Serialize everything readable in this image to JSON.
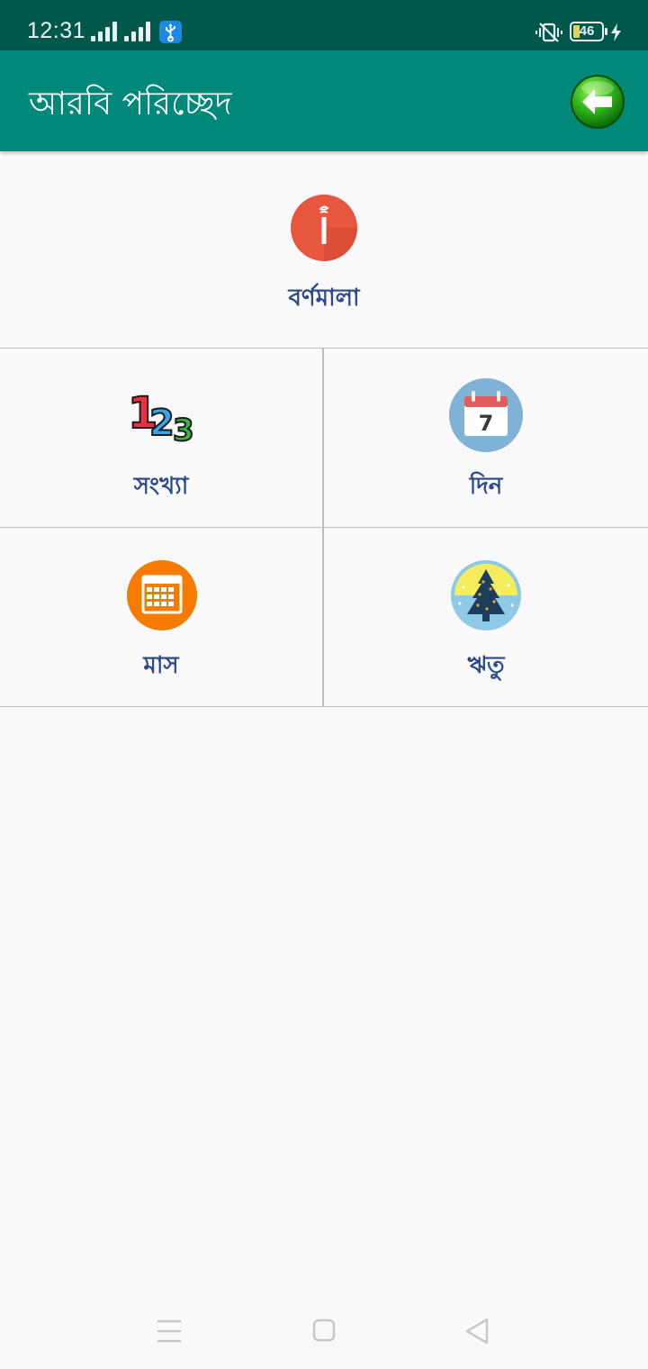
{
  "status_bar": {
    "time": "12:31",
    "battery_level": "46",
    "icons": [
      "signal-icon",
      "signal-icon",
      "usb-icon",
      "vibrate-icon",
      "battery-icon",
      "charging-icon"
    ]
  },
  "app_bar": {
    "title": "আরবি পরিচ্ছেদ",
    "back_icon": "back-arrow-icon",
    "colors": {
      "status": "#00574b",
      "toolbar": "#00897b"
    }
  },
  "menu": {
    "label_color": "#2b4a8a",
    "items": [
      {
        "label": "বর্ণমালা",
        "icon": "arabic-alif-icon"
      },
      {
        "label": "সংখ্যা",
        "icon": "numbers-123-icon"
      },
      {
        "label": "দিন",
        "icon": "calendar-day-icon"
      },
      {
        "label": "মাস",
        "icon": "calendar-month-icon"
      },
      {
        "label": "ঋতু",
        "icon": "season-tree-icon"
      }
    ]
  },
  "nav_bar": {
    "buttons": [
      "menu-icon",
      "home-icon",
      "back-icon"
    ]
  }
}
